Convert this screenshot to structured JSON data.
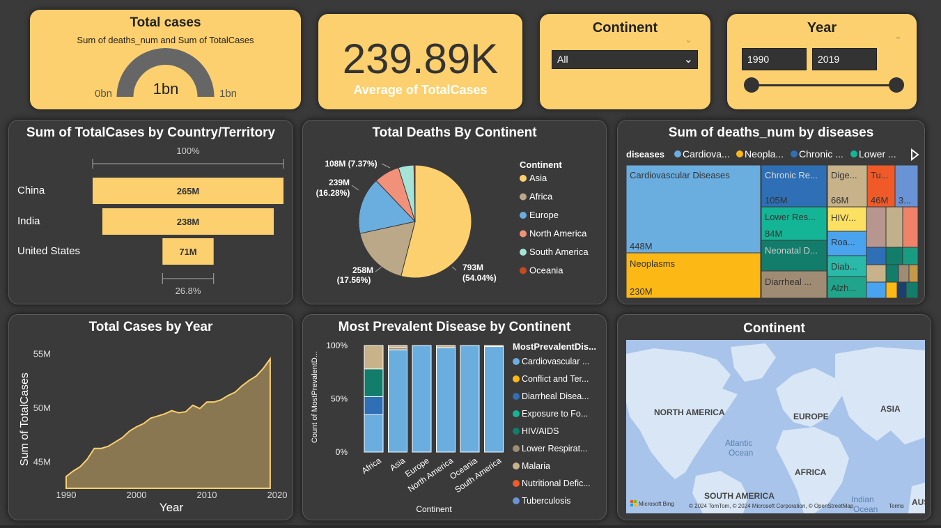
{
  "kpi_total": {
    "title": "Total cases",
    "subtitle": "Sum of deaths_num and Sum of TotalCases",
    "gauge_value": "1bn",
    "gauge_min": "0bn",
    "gauge_max": "1bn",
    "gauge_fraction": 1.0
  },
  "kpi_avg": {
    "value": "239.89K",
    "label": "Average of TotalCases"
  },
  "continent_slicer": {
    "title": "Continent",
    "selected": "All"
  },
  "year_slicer": {
    "title": "Year",
    "from": "1990",
    "to": "2019"
  },
  "colors": {
    "yellow": "#fcd06e",
    "panel": "#3a3a3a",
    "tan": "#897752"
  },
  "chart_data": [
    {
      "type": "bar",
      "title": "Sum of TotalCases by Country/Territory",
      "subtype": "funnel",
      "categories": [
        "China",
        "India",
        "United States"
      ],
      "values": [
        265,
        238,
        71
      ],
      "value_labels": [
        "265M",
        "238M",
        "71M"
      ],
      "top_label": "100%",
      "bottom_label": "26.8%"
    },
    {
      "type": "pie",
      "title": "Total Deaths By Continent",
      "legend_title": "Continent",
      "legend_position": "right",
      "slices": [
        {
          "name": "Asia",
          "value": 793,
          "pct": 54.04,
          "color": "#fcd06e",
          "label1": "793M",
          "label2": "(54.04%)"
        },
        {
          "name": "Africa",
          "value": 258,
          "pct": 17.56,
          "color": "#bba888",
          "label1": "258M",
          "label2": "(17.56%)"
        },
        {
          "name": "Europe",
          "value": 239,
          "pct": 16.28,
          "color": "#6aaee0",
          "label1": "239M",
          "label2": "(16.28%)"
        },
        {
          "name": "North America",
          "value": 108,
          "pct": 7.37,
          "color": "#f2917a",
          "label1": "108M (7.37%)",
          "label2": ""
        },
        {
          "name": "South America",
          "value": 65,
          "pct": 4.4,
          "color": "#a6e3d7",
          "label1": "",
          "label2": ""
        },
        {
          "name": "Oceania",
          "value": 5,
          "pct": 0.35,
          "color": "#c44a22",
          "label1": "",
          "label2": ""
        }
      ]
    },
    {
      "type": "heatmap",
      "subtype": "treemap",
      "title": "Sum of deaths_num by diseases",
      "legend_title": "diseases",
      "legend_items": [
        {
          "name": "Cardiova...",
          "color": "#6aaee0"
        },
        {
          "name": "Neopla...",
          "color": "#fcb814"
        },
        {
          "name": "Chronic ...",
          "color": "#2e6fb5"
        },
        {
          "name": "Lower ...",
          "color": "#14b496"
        }
      ],
      "tiles": [
        {
          "name": "Cardiovascular Diseases",
          "value": "448M"
        },
        {
          "name": "Neoplasms",
          "value": "230M"
        },
        {
          "name": "Chronic Re...",
          "value": "105M"
        },
        {
          "name": "Lower Res...",
          "value": "84M"
        },
        {
          "name": "Neonatal D...",
          "value": ""
        },
        {
          "name": "Diarrheal ...",
          "value": ""
        },
        {
          "name": "Dige...",
          "value": "66M"
        },
        {
          "name": "Tu...",
          "value": "46M"
        },
        {
          "name": "3...",
          "value": ""
        },
        {
          "name": "HIV/...",
          "value": ""
        },
        {
          "name": "Roa...",
          "value": ""
        },
        {
          "name": "Diab...",
          "value": ""
        },
        {
          "name": "Alzh...",
          "value": ""
        }
      ]
    },
    {
      "type": "area",
      "title": "Total Cases by Year",
      "xlabel": "Year",
      "ylabel": "Sum of TotalCases",
      "xlim": [
        1990,
        2020
      ],
      "ylim": [
        42.5,
        56
      ],
      "xticks": [
        "1990",
        "2000",
        "2010",
        "2020"
      ],
      "yticks": [
        "45M",
        "50M",
        "55M"
      ],
      "x": [
        1990,
        1991,
        1992,
        1993,
        1994,
        1995,
        1996,
        1997,
        1998,
        1999,
        2000,
        2001,
        2002,
        2003,
        2004,
        2005,
        2006,
        2007,
        2008,
        2009,
        2010,
        2011,
        2012,
        2013,
        2014,
        2015,
        2016,
        2017,
        2018,
        2019
      ],
      "values": [
        43.6,
        44.1,
        44.5,
        45.2,
        46.2,
        46.2,
        46.4,
        46.8,
        47.2,
        47.8,
        48.2,
        48.5,
        49.0,
        49.2,
        49.4,
        49.7,
        49.5,
        49.6,
        50.2,
        49.9,
        50.5,
        50.5,
        50.7,
        51.1,
        51.4,
        52.0,
        52.5,
        52.9,
        53.6,
        54.5
      ],
      "color": "#897752"
    },
    {
      "type": "bar",
      "subtype": "stacked-100",
      "title": "Most Prevalent Disease by Continent",
      "xlabel": "Continent",
      "ylabel": "Count of MostPrevalentD...",
      "yticks": [
        "0%",
        "50%",
        "100%"
      ],
      "legend_title": "MostPrevalentDis...",
      "legend_position": "right",
      "categories": [
        "Africa",
        "Asia",
        "Europe",
        "North America",
        "Oceania",
        "South America"
      ],
      "series": [
        {
          "name": "Cardiovascular ...",
          "color": "#6aaee0",
          "values": [
            35,
            96,
            100,
            98,
            100,
            99
          ]
        },
        {
          "name": "Conflict and Ter...",
          "color": "#fcb814",
          "values": [
            0,
            0,
            0,
            0,
            0,
            0
          ]
        },
        {
          "name": "Diarrheal Disea...",
          "color": "#2e6fb5",
          "values": [
            17,
            0,
            0,
            0,
            0,
            0
          ]
        },
        {
          "name": "Exposure to Fo...",
          "color": "#14b496",
          "values": [
            0,
            0,
            0,
            0,
            0,
            0
          ]
        },
        {
          "name": "HIV/AIDS",
          "color": "#127d6a",
          "values": [
            26,
            0,
            0,
            0,
            0,
            0
          ]
        },
        {
          "name": "Lower Respirat...",
          "color": "#a08c74",
          "values": [
            0,
            2,
            0,
            0,
            0,
            0
          ]
        },
        {
          "name": "Malaria",
          "color": "#c7b28a",
          "values": [
            22,
            2,
            0,
            2,
            0,
            1
          ]
        },
        {
          "name": "Nutritional Defic...",
          "color": "#f05a28",
          "values": [
            0,
            0,
            0,
            0,
            0,
            0
          ]
        },
        {
          "name": "Tuberculosis",
          "color": "#6a93d6",
          "values": [
            0,
            0,
            0,
            0,
            0,
            0
          ]
        }
      ]
    }
  ],
  "map": {
    "title": "Continent",
    "labels": [
      "NORTH AMERICA",
      "EUROPE",
      "ASIA",
      "AFRICA",
      "SOUTH AMERICA",
      "Atlantic",
      "Ocean",
      "Indian",
      "Ocean",
      "AUS"
    ],
    "logo": "Microsoft Bing",
    "attribution": "© 2024 TomTom, © 2024 Microsoft Corporation, © OpenStreetMap",
    "terms": "Terms"
  }
}
